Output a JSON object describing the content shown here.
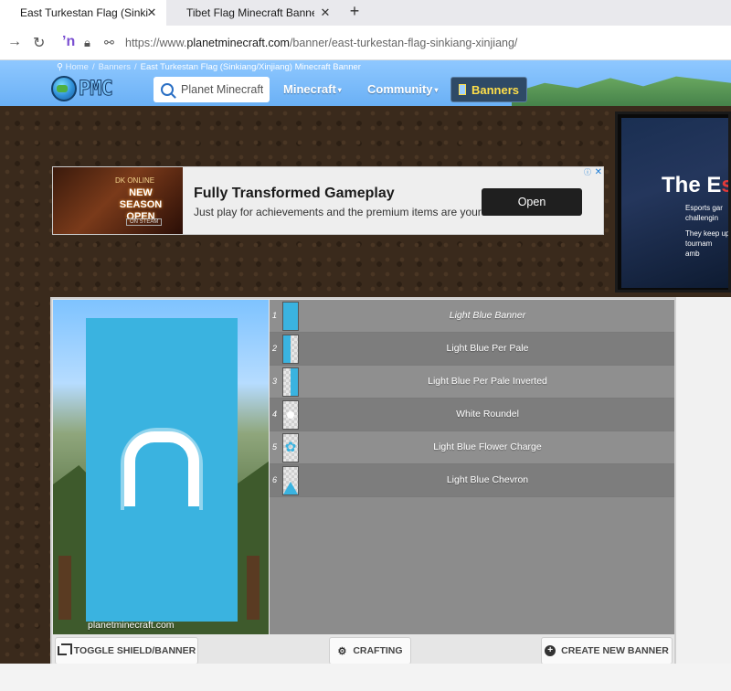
{
  "browser": {
    "tabs": [
      {
        "label": "East Turkestan Flag (Sinkiang/Xinjiang) Minecraft Banner",
        "active": true
      },
      {
        "label": "Tibet Flag Minecraft Banner",
        "active": false
      }
    ],
    "close_glyph": "✕",
    "new_tab_glyph": "+",
    "url_prefix": "https://www.",
    "url_domain": "planetminecraft.com",
    "url_path": "/banner/east-turkestan-flag-sinkiang-xinjiang/"
  },
  "site": {
    "breadcrumb": [
      {
        "label": "Home"
      },
      {
        "label": "Banners"
      },
      {
        "label": "East Turkestan Flag (Sinkiang/Xinjiang) Minecraft Banner"
      }
    ],
    "breadcrumb_sep": "/",
    "logo_text": "PMC",
    "search_placeholder": "Planet Minecraft",
    "nav": [
      {
        "label": "Minecraft"
      },
      {
        "label": "Community"
      }
    ],
    "nav_caret": "▾",
    "banners_label": "Banners"
  },
  "ad": {
    "brand": "DK ONLINE",
    "promo": "NEW SEASON OPEN",
    "store": "ON STEAM",
    "headline": "Fully Transformed Gameplay",
    "subline": "Just play for achievements and the premium items are yours!",
    "cta": "Open",
    "info_glyph": "ⓘ",
    "close_glyph": "✕"
  },
  "side_ad": {
    "title_white": "The E",
    "title_red": "s",
    "lines": [
      "Esports gar",
      "challengin",
      "",
      "They keep up-",
      "tournam",
      "amb"
    ]
  },
  "editor": {
    "watermark": "planetminecraft.com",
    "base_color": "#3ab3e0",
    "layers": [
      {
        "num": "1",
        "label": "Light Blue Banner",
        "pattern": "full"
      },
      {
        "num": "2",
        "label": "Light Blue Per Pale",
        "pattern": "pale-left"
      },
      {
        "num": "3",
        "label": "Light Blue Per Pale Inverted",
        "pattern": "pale-right"
      },
      {
        "num": "4",
        "label": "White Roundel",
        "pattern": "roundel"
      },
      {
        "num": "5",
        "label": "Light Blue Flower Charge",
        "pattern": "flower"
      },
      {
        "num": "6",
        "label": "Light Blue Chevron",
        "pattern": "chevron"
      }
    ],
    "buttons": {
      "toggle": "TOGGLE SHIELD/BANNER",
      "crafting": "CRAFTING",
      "create": "CREATE NEW BANNER"
    },
    "crafting_glyph": "⚙",
    "create_glyph": "+"
  }
}
